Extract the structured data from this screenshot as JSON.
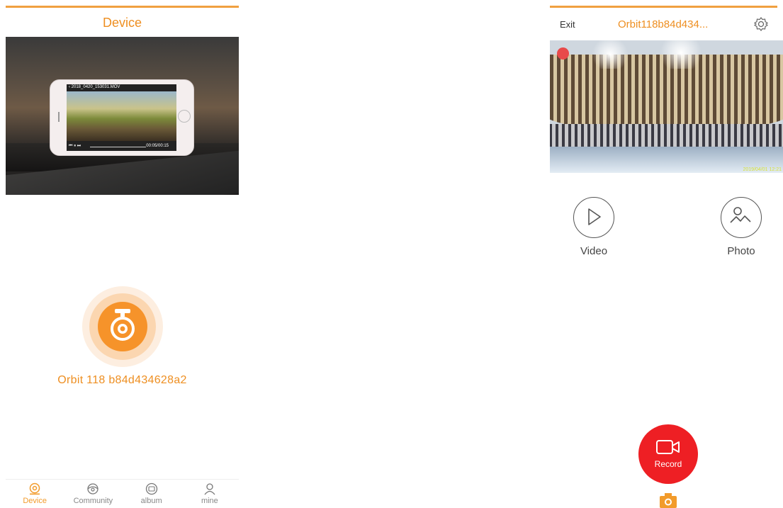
{
  "left_screen": {
    "title": "Device",
    "banner": {
      "mock_filename": "2018_0420_153031.MOV",
      "mock_time": "00:05/00:15",
      "page_dots": 3,
      "active_dot": 1
    },
    "device_name": "Orbit 118 b84d434628a2",
    "tabs": [
      {
        "label": "Device",
        "icon": "camera-icon",
        "active": true
      },
      {
        "label": "Community",
        "icon": "community-icon",
        "active": false
      },
      {
        "label": "album",
        "icon": "album-icon",
        "active": false
      },
      {
        "label": "mine",
        "icon": "person-icon",
        "active": false
      }
    ]
  },
  "right_screen": {
    "exit_label": "Exit",
    "title": "Orbit118b84d434...",
    "timestamp": "2019/04/01 12:21",
    "actions": {
      "video_label": "Video",
      "photo_label": "Photo"
    },
    "record_label": "Record"
  },
  "colors": {
    "accent": "#ee8f22",
    "record_red": "#ee1f24",
    "rec_indicator": "#e84a4a"
  }
}
